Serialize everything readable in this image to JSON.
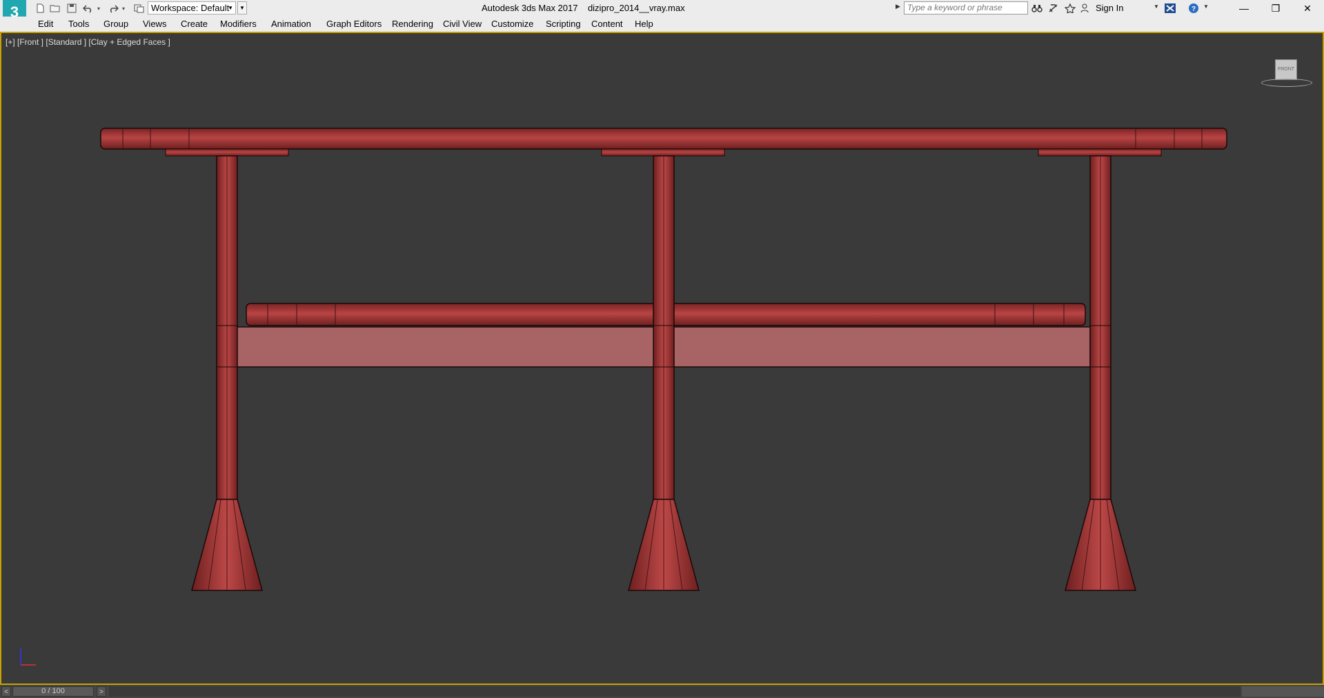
{
  "app": {
    "logo_text": "3",
    "title": "Autodesk 3ds Max 2017",
    "file_name": "dizipro_2014__vray.max"
  },
  "quick_access": {
    "workspace_label": "Workspace: Default",
    "icons": [
      "new-file-icon",
      "open-file-icon",
      "save-icon",
      "undo-icon",
      "redo-icon",
      "project-folder-icon"
    ]
  },
  "search": {
    "placeholder": "Type a keyword or phrase"
  },
  "account": {
    "sign_in_label": "Sign In"
  },
  "window_controls": {
    "minimize": "—",
    "restore": "❒",
    "close": "✕"
  },
  "menu": {
    "items": [
      "Edit",
      "Tools",
      "Group",
      "Views",
      "Create",
      "Modifiers",
      "Animation",
      "Graph Editors",
      "Rendering",
      "Civil View",
      "Customize",
      "Scripting",
      "Content",
      "Help"
    ]
  },
  "viewport": {
    "label": "[+] [Front ] [Standard ] [Clay + Edged Faces ]",
    "viewcube_face": "FRONT",
    "model_color": "#b03a3a",
    "background_color": "#3a3a3a",
    "active_border_color": "#c8a200"
  },
  "timeline": {
    "frame_readout": "0 / 100",
    "prev_label": "<",
    "next_label": ">"
  }
}
